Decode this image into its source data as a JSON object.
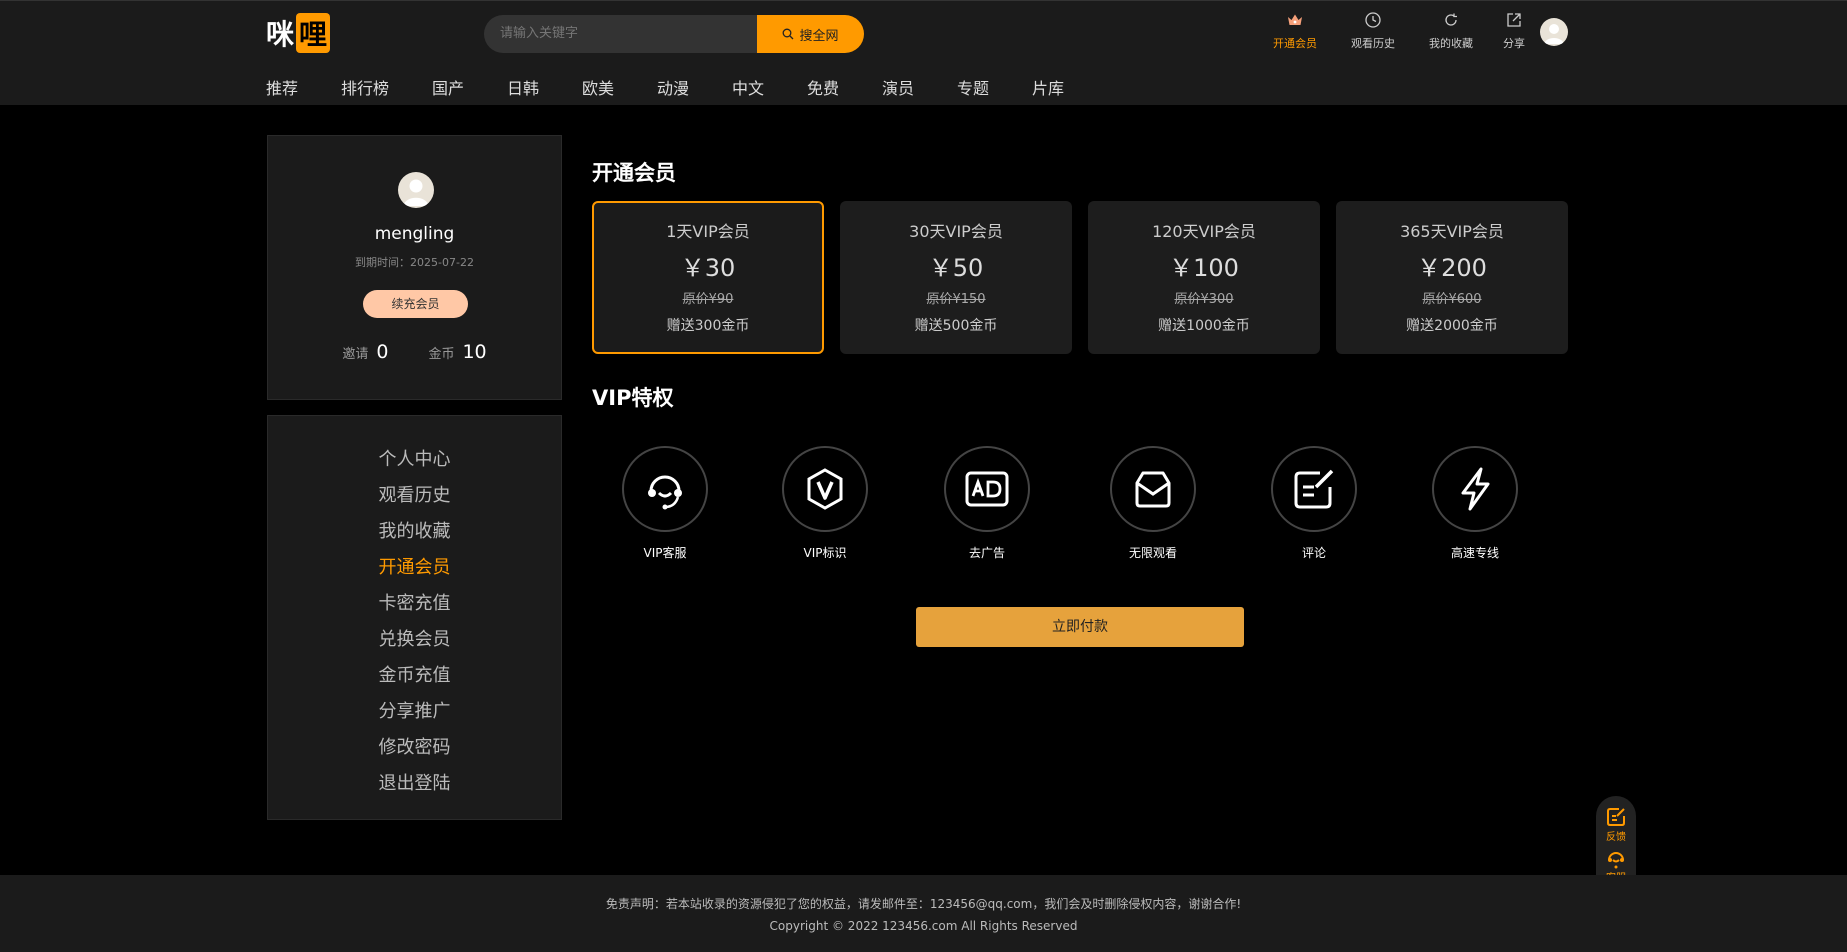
{
  "header": {
    "logo_part1": "咪",
    "logo_part2": "哩",
    "search_placeholder": "请输入关键字",
    "search_button": "搜全网",
    "links": [
      {
        "label": "开通会员",
        "icon": "crown-icon",
        "active": true
      },
      {
        "label": "观看历史",
        "icon": "clock-icon"
      },
      {
        "label": "我的收藏",
        "icon": "refresh-icon"
      },
      {
        "label": "分享",
        "icon": "share-icon"
      }
    ],
    "nav": [
      "推荐",
      "排行榜",
      "国产",
      "日韩",
      "欧美",
      "动漫",
      "中文",
      "免费",
      "演员",
      "专题",
      "片库"
    ]
  },
  "profile": {
    "username": "mengling",
    "expiry": "到期时间：2025-07-22",
    "renew_button": "续充会员",
    "invite_label": "邀请",
    "invite_value": "0",
    "coins_label": "金币",
    "coins_value": "10"
  },
  "menu": {
    "items": [
      "个人中心",
      "观看历史",
      "我的收藏",
      "开通会员",
      "卡密充值",
      "兑换会员",
      "金币充值",
      "分享推广",
      "修改密码",
      "退出登陆"
    ],
    "active_index": 3
  },
  "main": {
    "membership_title": "开通会员",
    "plans": [
      {
        "name": "1天VIP会员",
        "price": "￥30",
        "original": "原价¥90",
        "bonus": "赠送300金币",
        "selected": true
      },
      {
        "name": "30天VIP会员",
        "price": "￥50",
        "original": "原价¥150",
        "bonus": "赠送500金币"
      },
      {
        "name": "120天VIP会员",
        "price": "￥100",
        "original": "原价¥300",
        "bonus": "赠送1000金币"
      },
      {
        "name": "365天VIP会员",
        "price": "￥200",
        "original": "原价¥600",
        "bonus": "赠送2000金币"
      }
    ],
    "perks_title": "VIP特权",
    "perks": [
      {
        "label": "VIP客服",
        "icon": "headset-icon"
      },
      {
        "label": "VIP标识",
        "icon": "vip-badge-icon"
      },
      {
        "label": "去广告",
        "icon": "ad-icon"
      },
      {
        "label": "无限观看",
        "icon": "mail-icon"
      },
      {
        "label": "评论",
        "icon": "edit-icon"
      },
      {
        "label": "高速专线",
        "icon": "lightning-icon"
      }
    ],
    "pay_button": "立即付款"
  },
  "float": {
    "feedback": "反馈",
    "service": "客服"
  },
  "footer": {
    "disclaimer": "免责声明：若本站收录的资源侵犯了您的权益，请发邮件至：123456@qq.com，我们会及时删除侵权内容，谢谢合作!",
    "copyright": "Copyright © 2022 123456.com All Rights Reserved"
  },
  "colors": {
    "accent": "#ff9a00",
    "pay": "#e6a23c",
    "background": "#000000",
    "panel": "#1b1b1b"
  }
}
